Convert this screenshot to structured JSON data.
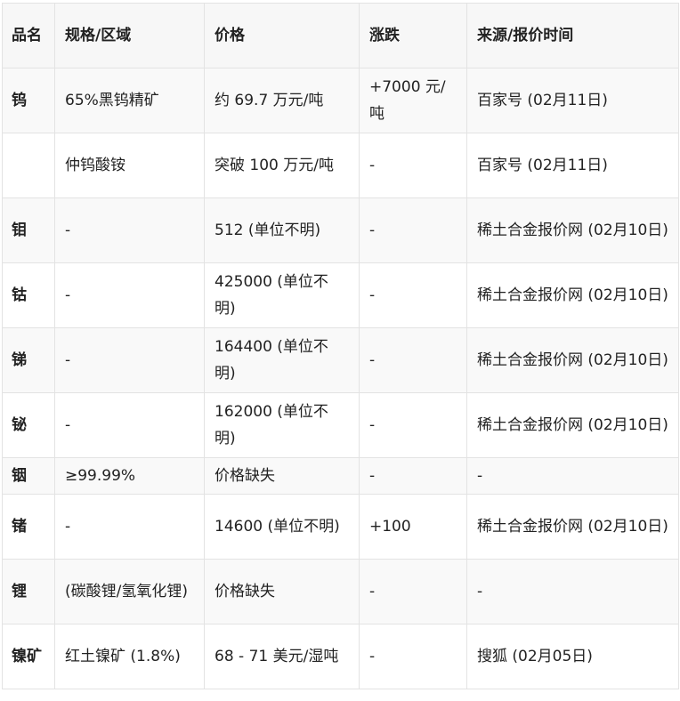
{
  "headers": [
    "品名",
    "规格/区域",
    "价格",
    "涨跌",
    "来源/报价时间"
  ],
  "rows": [
    [
      "钨",
      "65%黑钨精矿",
      "约 69.7 万元/吨",
      "+7000 元/吨",
      "百家号 (02月11日)"
    ],
    [
      "",
      "仲钨酸铵",
      "突破 100 万元/吨",
      "-",
      "百家号 (02月11日)"
    ],
    [
      "钼",
      "-",
      "512 (单位不明)",
      "-",
      "稀土合金报价网 (02月10日)"
    ],
    [
      "钴",
      "-",
      "425000 (单位不明)",
      "-",
      "稀土合金报价网 (02月10日)"
    ],
    [
      "锑",
      "-",
      "164400 (单位不明)",
      "-",
      "稀土合金报价网 (02月10日)"
    ],
    [
      "铋",
      "-",
      "162000 (单位不明)",
      "-",
      "稀土合金报价网 (02月10日)"
    ],
    [
      "铟",
      "≥99.99%",
      "价格缺失",
      "-",
      "-"
    ],
    [
      "锗",
      "-",
      "14600 (单位不明)",
      "+100",
      "稀土合金报价网 (02月10日)"
    ],
    [
      "锂",
      "(碳酸锂/氢氧化锂)",
      "价格缺失",
      "-",
      "-"
    ],
    [
      "镍矿",
      "红土镍矿 (1.8%)",
      "68 - 71 美元/湿吨",
      "-",
      "搜狐 (02月05日)"
    ]
  ]
}
